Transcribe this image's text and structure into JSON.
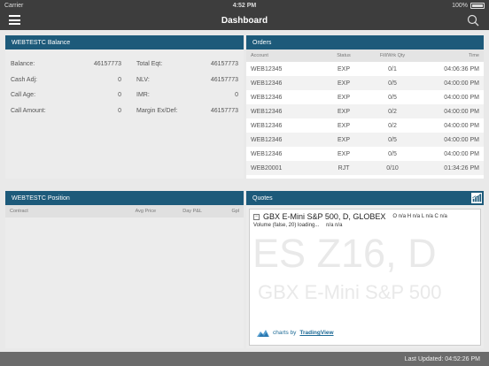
{
  "status_bar": {
    "carrier": "Carrier",
    "time": "4:52 PM",
    "battery": "100%"
  },
  "nav": {
    "title": "Dashboard",
    "menu_icon": "hamburger-menu-icon",
    "search_icon": "search-icon"
  },
  "balance": {
    "title": "WEBTESTC Balance",
    "rows": [
      {
        "l1": "Balance:",
        "v1": "46157773",
        "l2": "Total Eqt:",
        "v2": "46157773"
      },
      {
        "l1": "Cash Adj:",
        "v1": "0",
        "l2": "NLV:",
        "v2": "46157773"
      },
      {
        "l1": "Call Age:",
        "v1": "0",
        "l2": "IMR:",
        "v2": "0"
      },
      {
        "l1": "Call Amount:",
        "v1": "0",
        "l2": "Margin Ex/Def:",
        "v2": "46157773"
      }
    ]
  },
  "orders": {
    "title": "Orders",
    "headers": {
      "account": "Account",
      "status": "Status",
      "fill": "Fill/Wrk Qty",
      "time": "Time"
    },
    "rows": [
      {
        "account": "WEB12345",
        "status": "EXP",
        "fill": "0/1",
        "time": "04:06:36 PM"
      },
      {
        "account": "WEB12346",
        "status": "EXP",
        "fill": "0/5",
        "time": "04:00:00 PM"
      },
      {
        "account": "WEB12346",
        "status": "EXP",
        "fill": "0/5",
        "time": "04:00:00 PM"
      },
      {
        "account": "WEB12346",
        "status": "EXP",
        "fill": "0/2",
        "time": "04:00:00 PM"
      },
      {
        "account": "WEB12346",
        "status": "EXP",
        "fill": "0/2",
        "time": "04:00:00 PM"
      },
      {
        "account": "WEB12346",
        "status": "EXP",
        "fill": "0/5",
        "time": "04:00:00 PM"
      },
      {
        "account": "WEB12346",
        "status": "EXP",
        "fill": "0/5",
        "time": "04:00:00 PM"
      },
      {
        "account": "WEB20001",
        "status": "RJT",
        "fill": "0/10",
        "time": "01:34:26 PM"
      }
    ]
  },
  "position": {
    "title": "WEBTESTC Position",
    "headers": {
      "contract": "Contract",
      "avg": "Avg Price",
      "pnl": "Day P&L",
      "gpl": "Gpl"
    }
  },
  "quotes": {
    "title": "Quotes",
    "chart_icon": "bar-chart-icon",
    "symbol_title": "GBX E-Mini S&P 500, D, GLOBEX",
    "ohlc": "O n/a H n/a L n/a C n/a",
    "volume_label": "Volume (false, 20) loading...",
    "volume_value": "n/a n/a",
    "watermark_symbol": "ES Z16, D",
    "watermark_name": "GBX E-Mini S&P 500",
    "charts_by": "charts by",
    "tradingview": "TradingView"
  },
  "footer": {
    "last_updated": "Last Updated: 04:52:26 PM"
  },
  "colors": {
    "header": "#1d5a7a",
    "topbar": "#3d3d3d",
    "footer": "#6b6b6b"
  }
}
